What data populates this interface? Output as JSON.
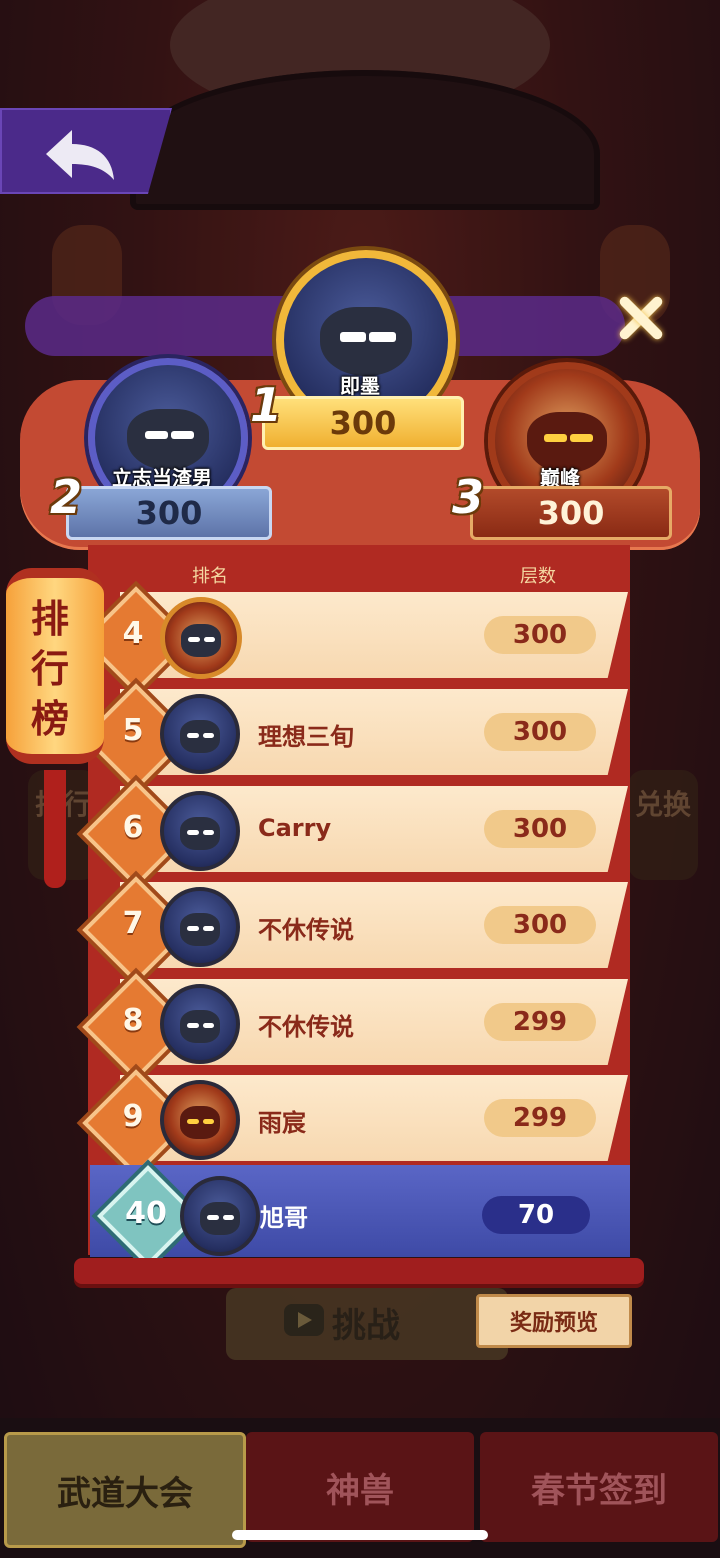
{
  "nav": {
    "back_icon": "back-arrow-icon",
    "close_icon": "close-icon"
  },
  "background": {
    "left_button": "排行",
    "right_button": "兑换"
  },
  "podium": [
    {
      "rank": "1",
      "name": "即墨",
      "score": "300",
      "avatar": "masked-ninja"
    },
    {
      "rank": "2",
      "name": "立志当渣男",
      "score": "300",
      "avatar": "masked-ninja"
    },
    {
      "rank": "3",
      "name": "巅峰",
      "score": "300",
      "avatar": "fire-warrior"
    }
  ],
  "lantern_title": [
    "排",
    "行",
    "榜"
  ],
  "board": {
    "header_rank": "排名",
    "header_floor": "层数",
    "rows": [
      {
        "rank": "4",
        "name": "",
        "score": "300",
        "avatar": "crest"
      },
      {
        "rank": "5",
        "name": "理想三旬",
        "score": "300",
        "avatar": "masked-ninja"
      },
      {
        "rank": "6",
        "name": "Carry",
        "score": "300",
        "avatar": "masked-ninja"
      },
      {
        "rank": "7",
        "name": "不休传说",
        "score": "300",
        "avatar": "masked-ninja"
      },
      {
        "rank": "8",
        "name": "不休传说",
        "score": "299",
        "avatar": "masked-ninja"
      },
      {
        "rank": "9",
        "name": "雨宸",
        "score": "299",
        "avatar": "fire-warrior"
      }
    ],
    "self": {
      "rank": "40",
      "name": "旭哥",
      "score": "70",
      "avatar": "masked-ninja"
    }
  },
  "actions": {
    "challenge_label": "挑战",
    "challenge_icon": "video-play-icon",
    "preview_label": "奖励预览"
  },
  "tabs": [
    {
      "label": "武道大会",
      "active": true
    },
    {
      "label": "神兽",
      "active": false
    },
    {
      "label": "春节签到",
      "active": false
    }
  ],
  "colors": {
    "board_red": "#b02a22",
    "row_cream": "#fde9cc",
    "self_row_blue": "#4a56b6",
    "gold_plate": "#f0b030"
  }
}
